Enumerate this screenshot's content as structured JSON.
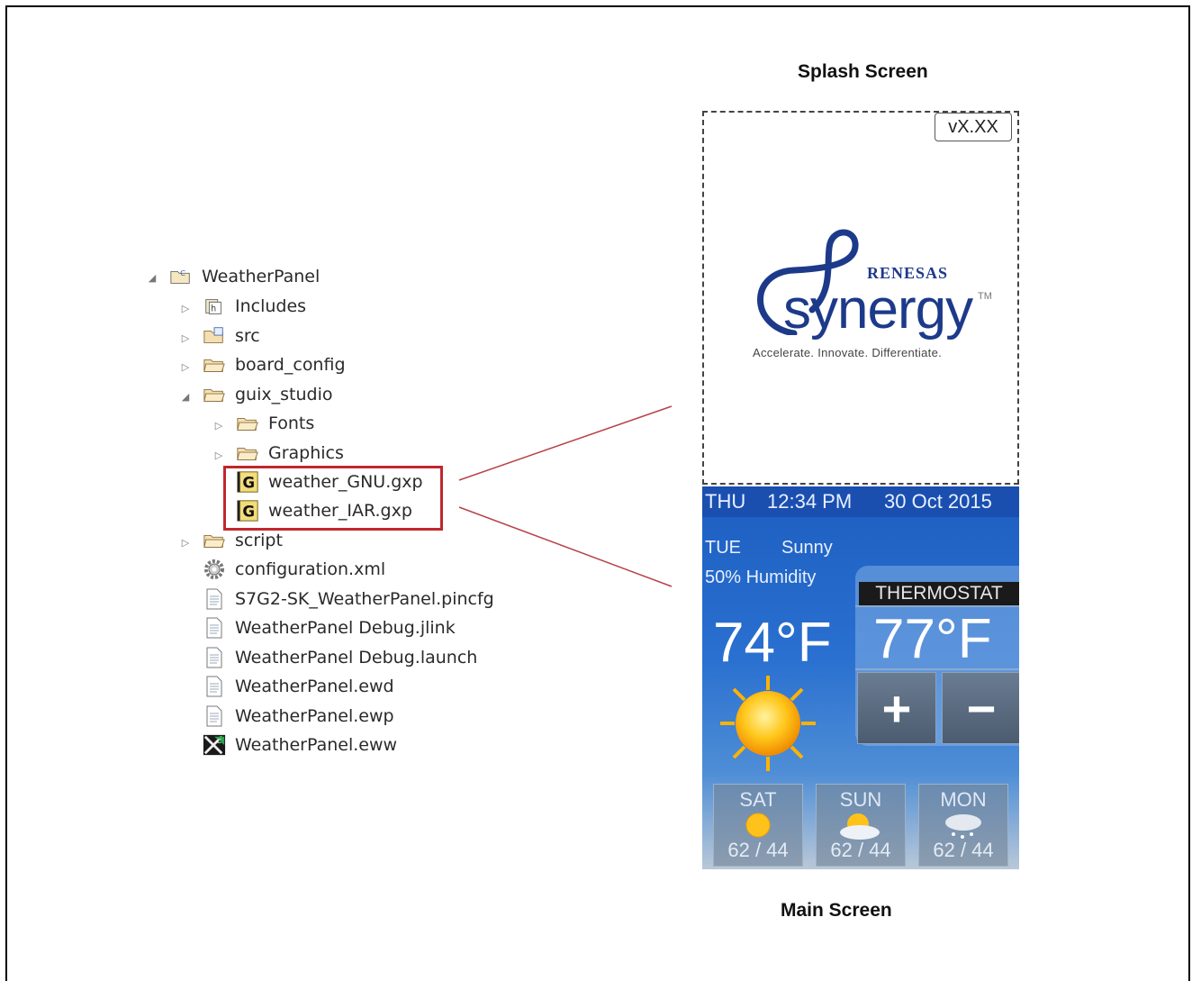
{
  "tree": {
    "project": "WeatherPanel",
    "items": [
      {
        "label": "Includes",
        "icon": "includes-folder-icon"
      },
      {
        "label": "src",
        "icon": "source-folder-icon"
      },
      {
        "label": "board_config",
        "icon": "folder-icon"
      },
      {
        "label": "guix_studio",
        "icon": "folder-icon"
      },
      {
        "label": "Fonts",
        "icon": "folder-icon"
      },
      {
        "label": "Graphics",
        "icon": "folder-icon"
      },
      {
        "label": "weather_GNU.gxp",
        "icon": "guix-file-icon"
      },
      {
        "label": "weather_IAR.gxp",
        "icon": "guix-file-icon"
      },
      {
        "label": "script",
        "icon": "folder-icon"
      },
      {
        "label": "configuration.xml",
        "icon": "gear-icon"
      },
      {
        "label": "S7G2-SK_WeatherPanel.pincfg",
        "icon": "file-icon"
      },
      {
        "label": "WeatherPanel Debug.jlink",
        "icon": "file-icon"
      },
      {
        "label": "WeatherPanel Debug.launch",
        "icon": "file-icon"
      },
      {
        "label": "WeatherPanel.ewd",
        "icon": "file-icon"
      },
      {
        "label": "WeatherPanel.ewp",
        "icon": "file-icon"
      },
      {
        "label": "WeatherPanel.eww",
        "icon": "iar-workspace-icon"
      }
    ]
  },
  "splash": {
    "caption": "Splash Screen",
    "version": "vX.XX",
    "brand": "RENESAS",
    "product": "synergy",
    "tm": "TM",
    "tagline": "Accelerate. Innovate. Differentiate."
  },
  "main": {
    "caption": "Main Screen",
    "day": "THU",
    "time": "12:34 PM",
    "date": "30 Oct 2015",
    "forecast_day": "TUE",
    "condition": "Sunny",
    "humidity": "50% Humidity",
    "thermostat_label": "THERMOSTAT",
    "current_temp": "74°F",
    "set_temp": "77°F",
    "plus": "+",
    "minus": "−",
    "forecast": [
      {
        "day": "SAT",
        "temps": "62 / 44",
        "icon": "sun-icon"
      },
      {
        "day": "SUN",
        "temps": "62 / 44",
        "icon": "partly-cloudy-icon"
      },
      {
        "day": "MON",
        "temps": "62 / 44",
        "icon": "snow-cloud-icon"
      }
    ]
  },
  "colors": {
    "highlight": "#c0272d",
    "brand_blue": "#1d3a8a",
    "screen_blue": "#1c5ec1"
  }
}
